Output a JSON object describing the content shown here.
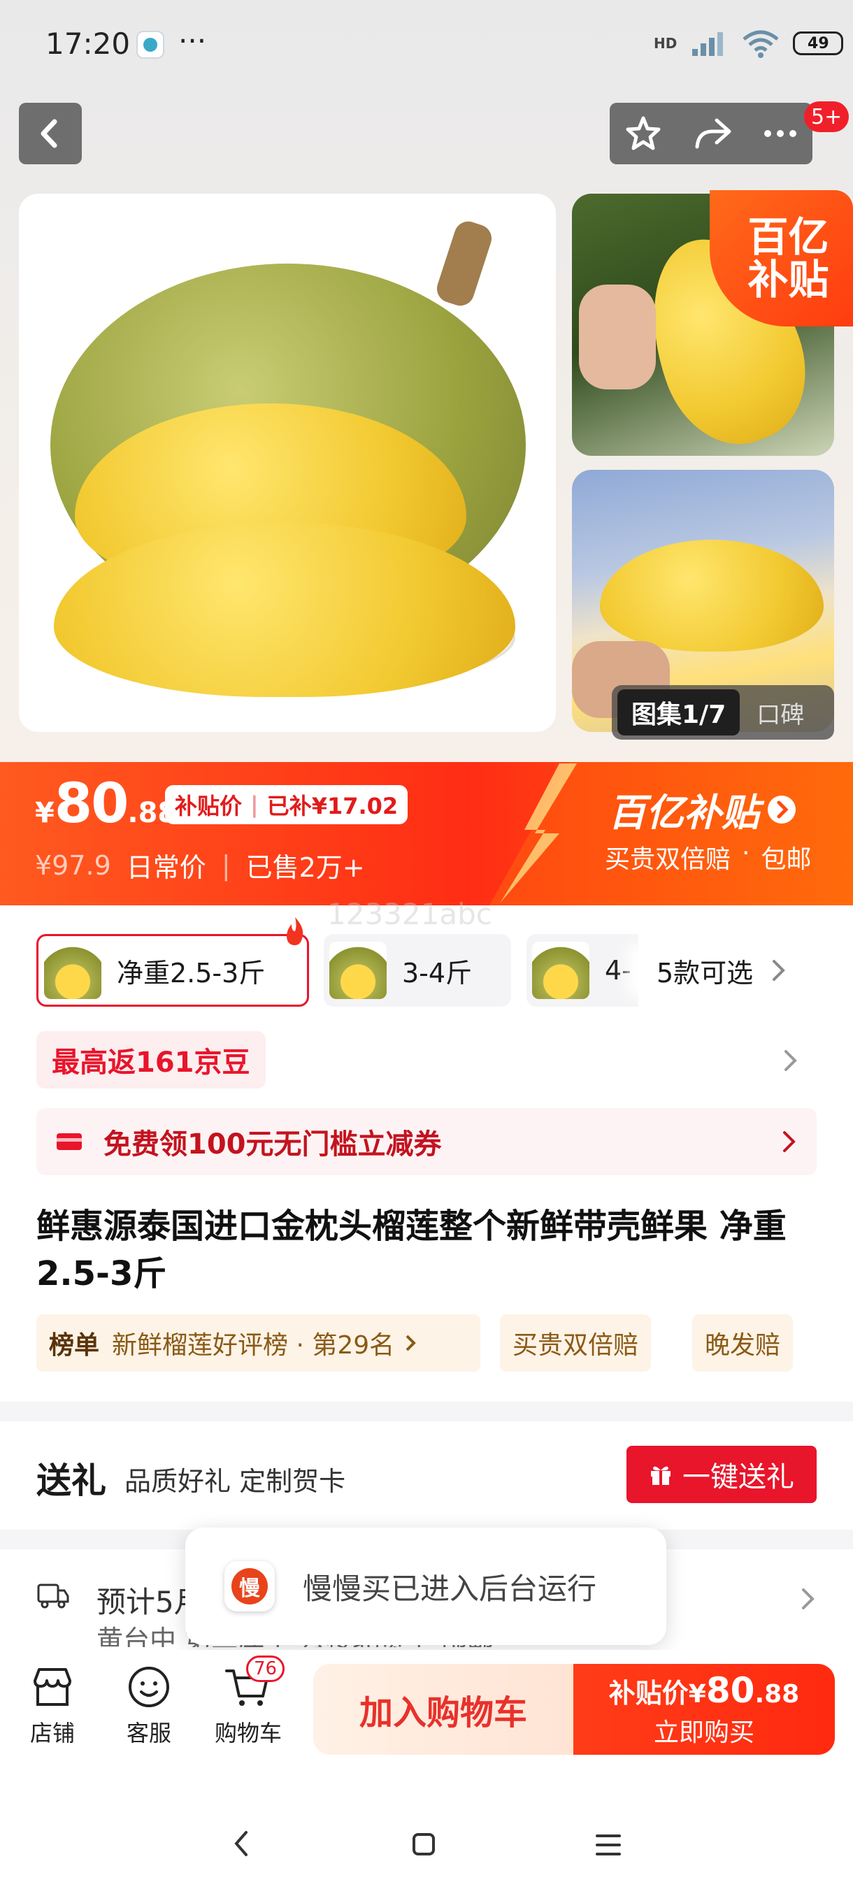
{
  "status_bar": {
    "time": "17:20",
    "dots": "···",
    "network": "HD",
    "battery": "49"
  },
  "top_bar": {
    "notification_badge": "5+"
  },
  "gallery": {
    "counter": "图集1/7",
    "review_tab": "口碑",
    "subsidy_badge_line1": "百亿",
    "subsidy_badge_line2": "补贴"
  },
  "price": {
    "currency": "¥",
    "integer": "80",
    "decimal": ".88",
    "subsidy_label": "补贴价",
    "subsidy_amount": "已补¥17.02",
    "original": "¥97.9",
    "original_label": "日常价",
    "sold": "已售2万+",
    "brand_title": "百亿补贴",
    "brand_sub1": "买贵双倍赔",
    "brand_sub2": "包邮"
  },
  "watermark": "123321abc",
  "variants": {
    "items": [
      {
        "label": "净重2.5-3斤"
      },
      {
        "label": "3-4斤"
      },
      {
        "label": "4-"
      }
    ],
    "more": "5款可选"
  },
  "promo": {
    "jd_beans": "最高返161京豆",
    "coupon": "免费领100元无门槛立减券"
  },
  "product_title": "鲜惠源泰国进口金枕头榴莲整个新鲜带壳鲜果 净重2.5-3斤",
  "tags": {
    "rank_label": "榜单",
    "rank_text": "新鲜榴莲好评榜 · 第29名",
    "double_refund": "买贵双倍赔",
    "late_refund": "晚发赔"
  },
  "gift": {
    "title": "送礼",
    "desc": "品质好礼 定制贺卡",
    "button": "一键送礼"
  },
  "delivery": {
    "line1": "预计5月",
    "line2": "黄台中 第二库里 云楼北贯子 部邮"
  },
  "toast": {
    "icon_char": "慢",
    "text": "慢慢买已进入后台运行"
  },
  "bottom_bar": {
    "store": "店铺",
    "service": "客服",
    "cart": "购物车",
    "cart_count": "76",
    "add_cart": "加入购物车",
    "buy_price_label": "补贴价",
    "buy_currency": "¥",
    "buy_int": "80",
    "buy_dec": ".88",
    "buy_now": "立即购买"
  },
  "colors": {
    "accent": "#ff2d14",
    "brand_red": "#e8152b",
    "orange": "#ff5a1f"
  }
}
